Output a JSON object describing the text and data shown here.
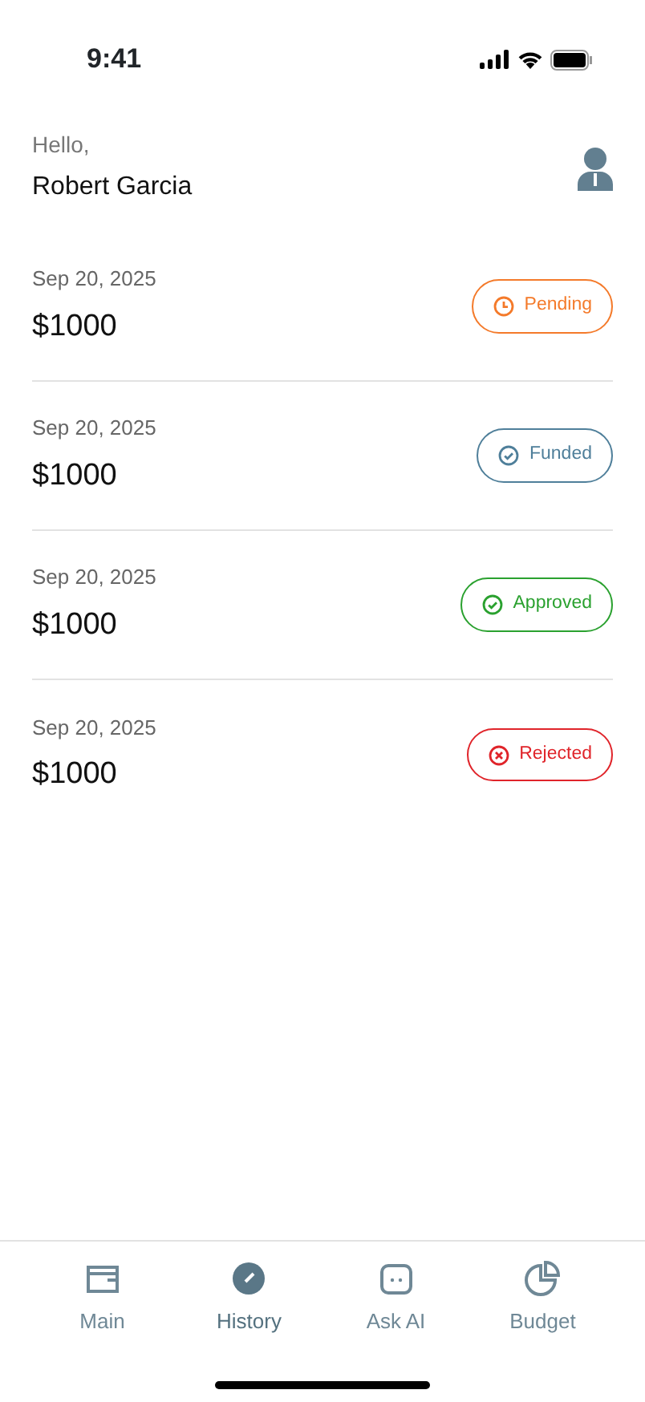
{
  "status_bar": {
    "time": "9:41"
  },
  "greeting": {
    "hello": "Hello,",
    "name": "Robert Garcia"
  },
  "requests": [
    {
      "date": "Sep 20, 2025",
      "amount": "$1000",
      "status": {
        "label": "Pending",
        "kind": "pending",
        "color": "#f47a2a"
      }
    },
    {
      "date": "Sep 20, 2025",
      "amount": "$1000",
      "status": {
        "label": "Funded",
        "kind": "funded",
        "color": "#4f7f9a"
      }
    },
    {
      "date": "Sep 20, 2025",
      "amount": "$1000",
      "status": {
        "label": "Approved",
        "kind": "approved",
        "color": "#2aa12f"
      }
    },
    {
      "date": "Sep 20, 2025",
      "amount": "$1000",
      "status": {
        "label": "Rejected",
        "kind": "rejected",
        "color": "#e0242a"
      }
    }
  ],
  "tabs": [
    {
      "label": "Main",
      "kind": "wallet",
      "selected": false
    },
    {
      "label": "History",
      "kind": "history",
      "selected": true
    },
    {
      "label": "Ask AI",
      "kind": "chat",
      "selected": false
    },
    {
      "label": "Budget",
      "kind": "budget",
      "selected": false
    }
  ]
}
